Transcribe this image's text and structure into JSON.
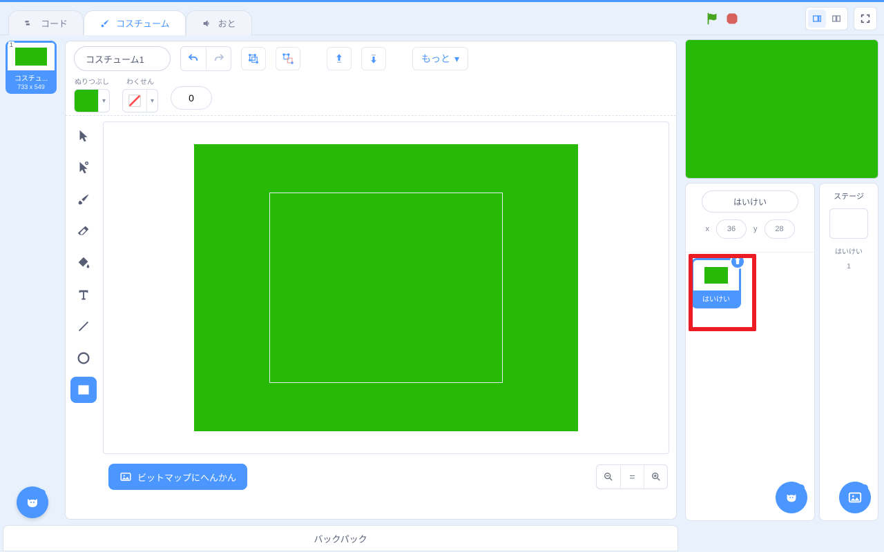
{
  "tabs": {
    "code": "コード",
    "costumes": "コスチューム",
    "sounds": "おと"
  },
  "costume": {
    "name": "コスチューム1",
    "thumbLabel": "コスチュ...",
    "thumbSize": "733 x 549",
    "thumbNum": "1"
  },
  "labels": {
    "fill": "ぬりつぶし",
    "outline": "わくせん",
    "more": "もっと",
    "lineWidth": "0",
    "bitmap": "ビットマップにへんかん",
    "backpack": "バックパック"
  },
  "sprite": {
    "name": "はいけい",
    "x": "x",
    "xval": "36",
    "y": "y",
    "yval": "28",
    "itemLabel": "はいけい"
  },
  "stage": {
    "title": "ステージ",
    "caption": "はいけい",
    "count": "1"
  },
  "colors": {
    "green": "#28b806",
    "blue": "#4c97ff",
    "red": "#eb1c24"
  }
}
